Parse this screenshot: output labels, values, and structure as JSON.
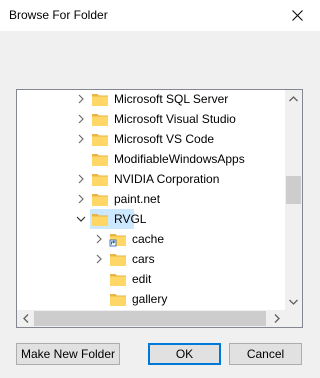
{
  "window": {
    "title": "Browse For Folder"
  },
  "tree": {
    "items": [
      {
        "label": "Microsoft SQL Server",
        "level": 0,
        "expander": "collapsed",
        "icon": "folder-icon"
      },
      {
        "label": "Microsoft Visual Studio",
        "level": 0,
        "expander": "collapsed",
        "icon": "folder-icon"
      },
      {
        "label": "Microsoft VS Code",
        "level": 0,
        "expander": "collapsed",
        "icon": "folder-icon"
      },
      {
        "label": "ModifiableWindowsApps",
        "level": 0,
        "expander": "none",
        "icon": "folder-icon"
      },
      {
        "label": "NVIDIA Corporation",
        "level": 0,
        "expander": "collapsed",
        "icon": "folder-icon"
      },
      {
        "label": "paint.net",
        "level": 0,
        "expander": "collapsed",
        "icon": "folder-icon"
      },
      {
        "label": "RVGL",
        "level": 0,
        "expander": "expanded",
        "icon": "folder-icon",
        "selected": true
      },
      {
        "label": "cache",
        "level": 1,
        "expander": "collapsed",
        "icon": "folder-shortcut-icon"
      },
      {
        "label": "cars",
        "level": 1,
        "expander": "collapsed",
        "icon": "folder-icon"
      },
      {
        "label": "edit",
        "level": 1,
        "expander": "none",
        "icon": "folder-icon"
      },
      {
        "label": "gallery",
        "level": 1,
        "expander": "none",
        "icon": "folder-icon"
      }
    ]
  },
  "buttons": {
    "make_new_folder": "Make New Folder",
    "ok": "OK",
    "cancel": "Cancel"
  },
  "colors": {
    "selection": "#cce8ff",
    "folder": "#ffd767",
    "accent": "#0078d7"
  }
}
